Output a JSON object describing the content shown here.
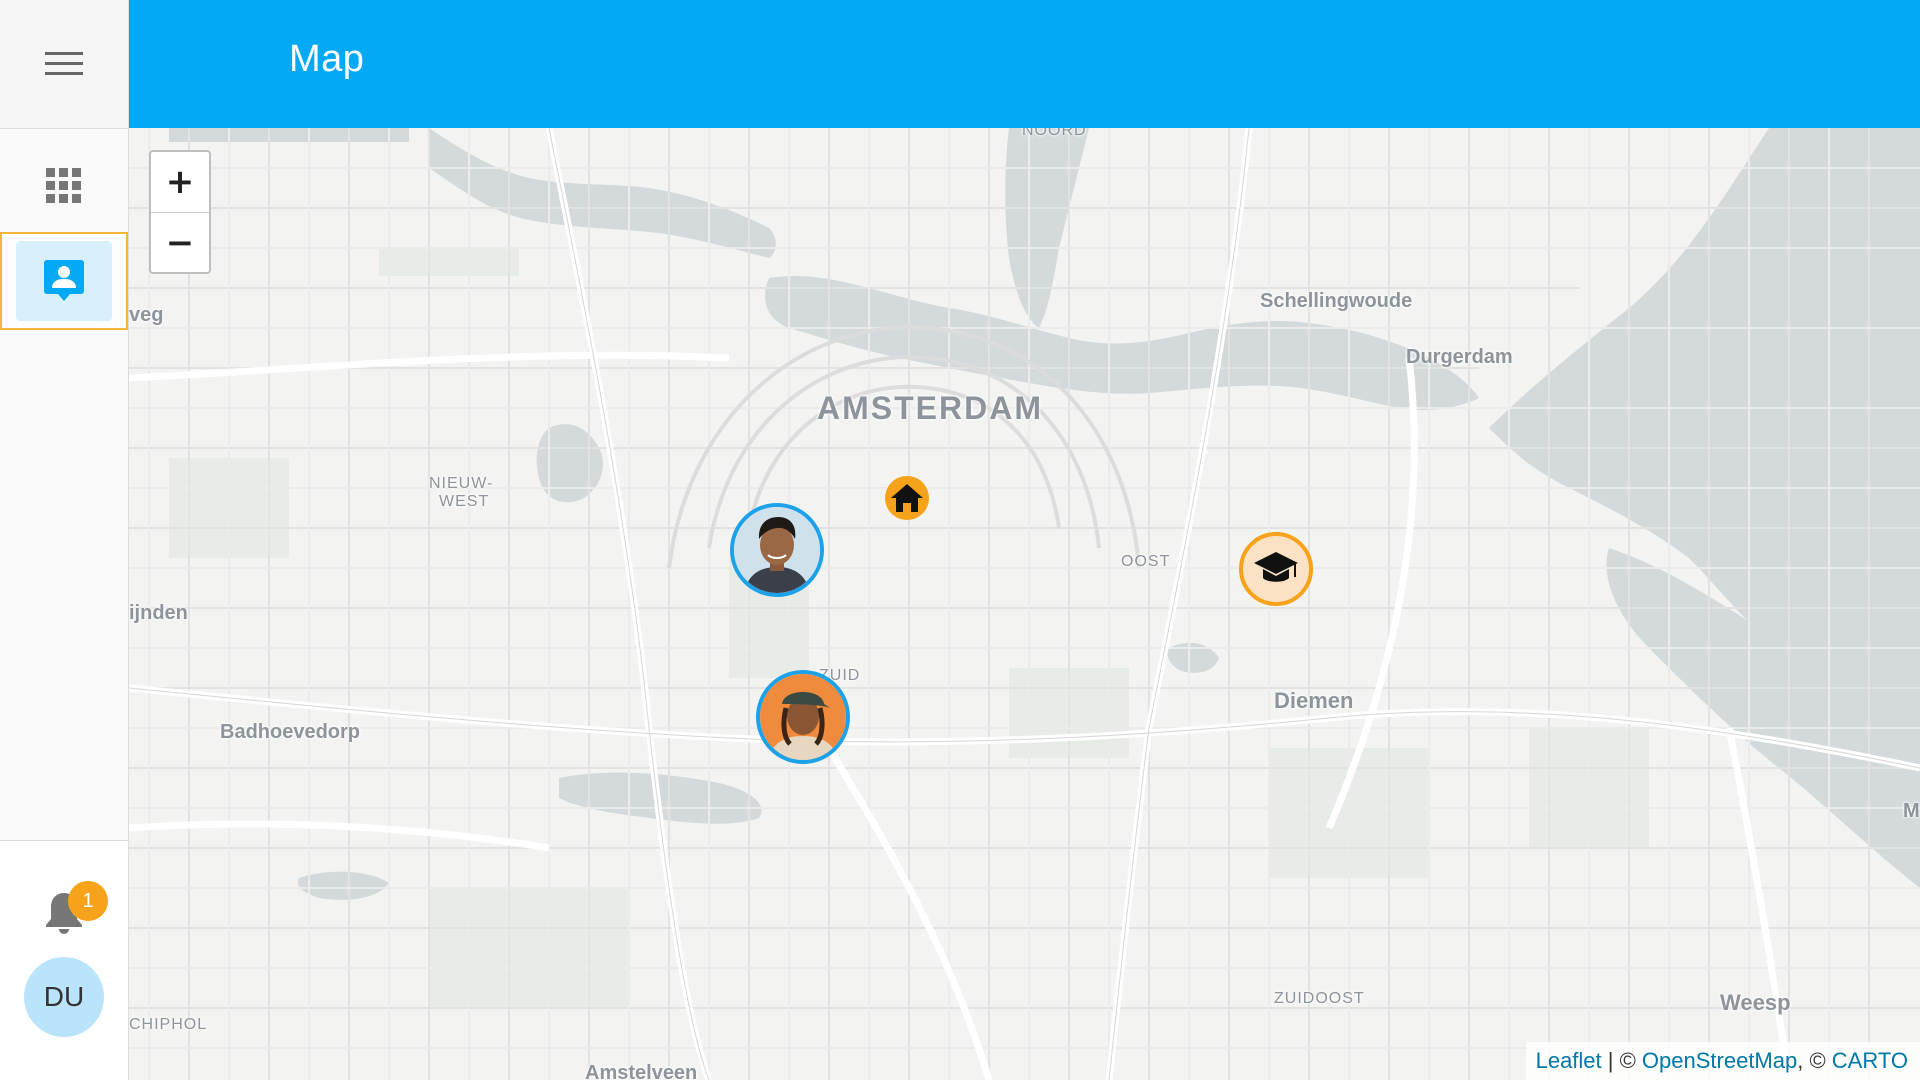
{
  "header": {
    "title": "Map"
  },
  "sidebar": {
    "menu_icon": "hamburger-menu-icon",
    "items": [
      {
        "id": "apps",
        "icon": "apps-grid-icon",
        "active": false
      },
      {
        "id": "people",
        "icon": "contact-card-icon",
        "active": true
      }
    ],
    "notifications": {
      "icon": "bell-icon",
      "count": "1"
    },
    "user": {
      "initials": "DU"
    }
  },
  "map": {
    "zoom_in": "+",
    "zoom_out": "−",
    "labels": {
      "amsterdam": "AMSTERDAM",
      "noord": "NOORD",
      "schellingwoude": "Schellingwoude",
      "durgerdam": "Durgerdam",
      "nieuw_west_1": "NIEUW-",
      "nieuw_west_2": "WEST",
      "oost": "OOST",
      "zuid": "ZUID",
      "diemen": "Diemen",
      "badhoevedorp": "Badhoevedorp",
      "zuidoost": "ZUIDOOST",
      "weesp": "Weesp",
      "schiphol": "CHIPHOL",
      "amstelveen": "Amstelveen",
      "veg": "veg",
      "ijnden": "ijnden",
      "m_edge": "M"
    },
    "markers": [
      {
        "type": "home",
        "icon": "home-icon",
        "color": "#f7a21b"
      },
      {
        "type": "school",
        "icon": "graduation-cap-icon",
        "color": "#f7a21b"
      },
      {
        "type": "person",
        "icon": "person-avatar-1"
      },
      {
        "type": "person",
        "icon": "person-avatar-2"
      }
    ],
    "attribution": {
      "leaflet": "Leaflet",
      "sep1": " | © ",
      "osm": "OpenStreetMap",
      "sep2": ", © ",
      "carto": "CARTO"
    }
  },
  "colors": {
    "header": "#03a9f4",
    "accent": "#f7a21b",
    "water": "#d4dadc",
    "land": "#f3f3f1"
  }
}
